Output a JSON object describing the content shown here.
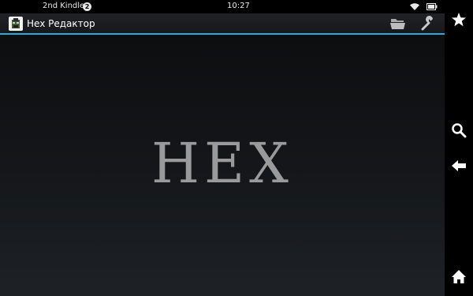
{
  "status_bar": {
    "device_name": "2nd Kindle",
    "notification_count": "2",
    "time": "10:27",
    "icons": [
      "wifi-icon",
      "battery-icon"
    ]
  },
  "action_bar": {
    "title": "Hex Редактор",
    "actions": [
      "folder-icon",
      "wrench-icon"
    ]
  },
  "main": {
    "logo_text": "HEX"
  },
  "nav_bar": {
    "buttons": [
      "favorites-star-icon",
      "search-icon",
      "back-arrow-icon",
      "home-icon"
    ]
  },
  "colors": {
    "accent": "#33a7d6",
    "logo": "#9a9a9a",
    "background": "#000000"
  }
}
